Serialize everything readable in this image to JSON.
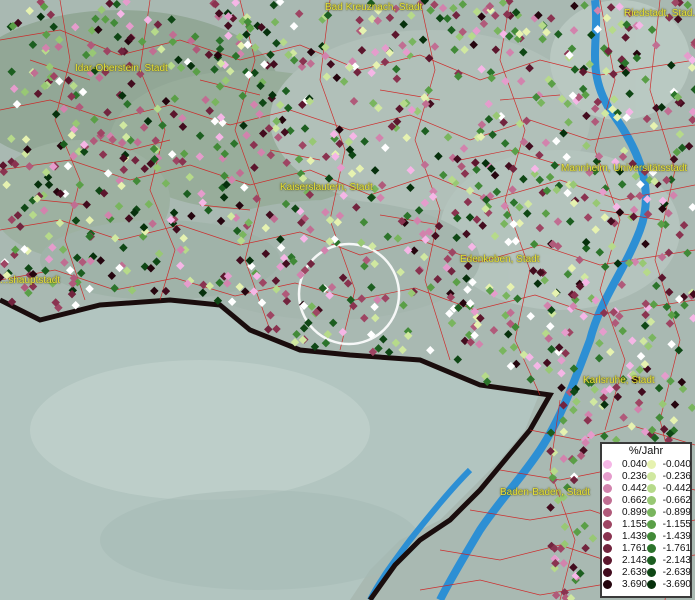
{
  "labels": [
    {
      "name": "bad-kreuznach",
      "text": "Bad Kreuznach, Stadt"
    },
    {
      "name": "idar-oberstein",
      "text": "Idar-Oberstein, Stadt"
    },
    {
      "name": "kaiserslautern",
      "text": "Kaiserslautern, Stadt"
    },
    {
      "name": "mannheim",
      "text": "Mannheim, Universitätsstadt"
    },
    {
      "name": "edenkoben",
      "text": "Edenkoben, Stadt"
    },
    {
      "name": "pirmasens",
      "text": "...shauptstadt"
    },
    {
      "name": "karlsruhe",
      "text": "Karlsruhe, Stadt"
    },
    {
      "name": "baden-baden",
      "text": "Baden-Baden, Stadt"
    },
    {
      "name": "riedstadt",
      "text": "Riedstadt, Stad..."
    }
  ],
  "legend": {
    "title": "%/Jahr",
    "positive": {
      "values": [
        "0.040",
        "0.236",
        "0.442",
        "0.662",
        "0.899",
        "1.155",
        "1.439",
        "1.761",
        "2.143",
        "2.639",
        "3.690"
      ],
      "colors": [
        "#f5b6e6",
        "#e59ccc",
        "#d283ad",
        "#c06e92",
        "#b05a7a",
        "#9e4563",
        "#8a3350",
        "#72243e",
        "#5c162d",
        "#420c1e",
        "#25050e"
      ]
    },
    "negative": {
      "values": [
        "-0.040",
        "-0.236",
        "-0.442",
        "-0.662",
        "-0.899",
        "-1.155",
        "-1.439",
        "-1.761",
        "-2.143",
        "-2.639",
        "-3.690"
      ],
      "colors": [
        "#e6f2b0",
        "#d0e8a0",
        "#b6da8a",
        "#98c874",
        "#79b55e",
        "#5a9f47",
        "#428a38",
        "#2c742b",
        "#1c5e20",
        "#0f4715",
        "#06300c"
      ]
    }
  }
}
